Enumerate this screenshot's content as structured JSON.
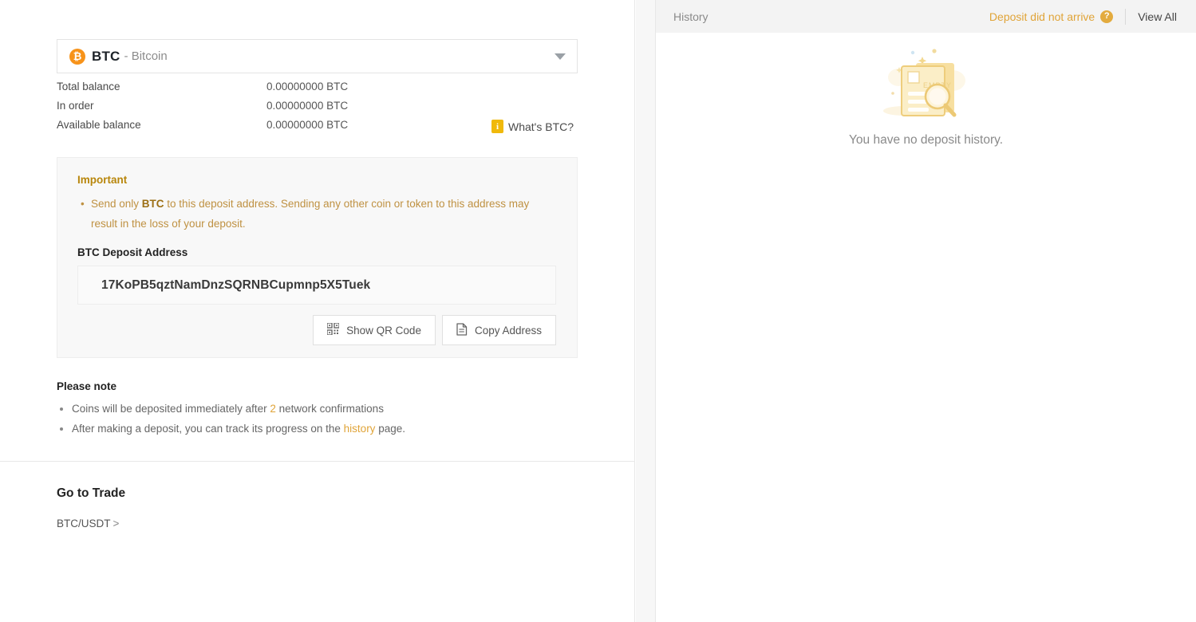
{
  "coin_selector": {
    "symbol": "BTC",
    "name": "- Bitcoin",
    "logo_glyph": "₿",
    "caret_icon": "chevron-down-icon",
    "accent_color": "#f7931a"
  },
  "balances": {
    "rows": [
      {
        "label": "Total balance",
        "value": "0.00000000 BTC"
      },
      {
        "label": "In order",
        "value": "0.00000000 BTC"
      },
      {
        "label": "Available balance",
        "value": "0.00000000 BTC"
      }
    ],
    "whats_btc_label": "What's BTC?",
    "info_glyph": "i"
  },
  "important": {
    "title": "Important",
    "warning_prefix": "Send only ",
    "warning_bold": "BTC",
    "warning_suffix": " to this deposit address. Sending any other coin or token to this address may result in the loss of your deposit.",
    "address_title": "BTC Deposit Address",
    "address": "17KoPB5qztNamDnzSQRNBCupmnp5X5Tuek",
    "show_qr_label": "Show QR Code",
    "copy_label": "Copy Address",
    "accent_color": "#bf9142"
  },
  "please_note": {
    "title": "Please note",
    "note1_prefix": "Coins will be deposited immediately after ",
    "note1_highlight": "2",
    "note1_suffix": " network confirmations",
    "note2_prefix": "After making a deposit, you can track its progress on the ",
    "note2_link": "history",
    "note2_suffix": " page.",
    "highlight_color": "#e0a438"
  },
  "trade": {
    "title": "Go to Trade",
    "pair": "BTC/USDT",
    "chevron": ">"
  },
  "history": {
    "title": "History",
    "no_arrive_label": "Deposit did not arrive",
    "help_glyph": "?",
    "view_all_label": "View All",
    "empty_message": "You have no deposit history.",
    "empty_doc_label": "EMPTY"
  }
}
